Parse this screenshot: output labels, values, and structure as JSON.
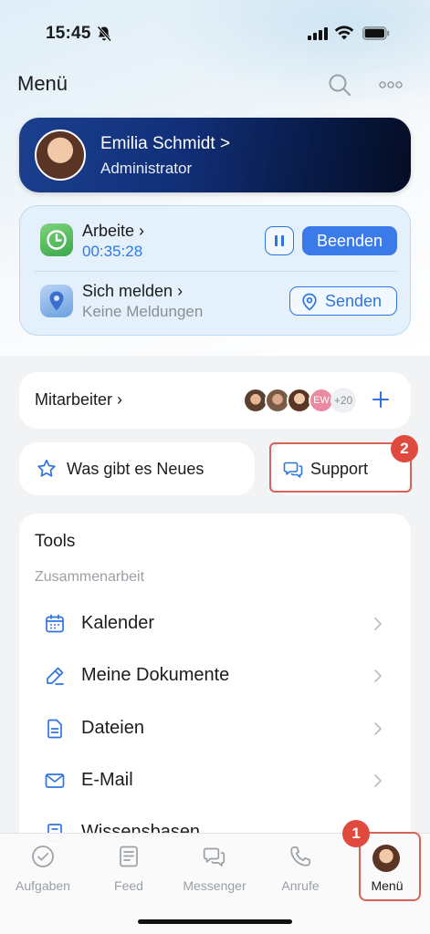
{
  "status_bar": {
    "time": "15:45"
  },
  "header": {
    "title": "Menü"
  },
  "profile": {
    "name": "Emilia Schmidt",
    "name_suffix": ">",
    "role": "Administrator"
  },
  "work": {
    "status_label": "Arbeite",
    "timer": "00:35:28",
    "end_label": "Beenden",
    "report_label": "Sich melden",
    "report_sub": "Keine Meldungen",
    "send_label": "Senden"
  },
  "employees": {
    "label": "Mitarbeiter",
    "initials": "EW",
    "more_count": "+20"
  },
  "news": {
    "label": "Was gibt es Neues"
  },
  "support": {
    "label": "Support"
  },
  "annotations": {
    "step1": "1",
    "step2": "2",
    "color": "#d8635b"
  },
  "tools": {
    "title": "Tools",
    "section": "Zusammenarbeit",
    "items": [
      {
        "label": "Kalender",
        "icon": "calendar-icon"
      },
      {
        "label": "Meine Dokumente",
        "icon": "pen-icon"
      },
      {
        "label": "Dateien",
        "icon": "file-icon"
      },
      {
        "label": "E-Mail",
        "icon": "mail-icon"
      },
      {
        "label": "Wissensbasen",
        "icon": "book-icon"
      }
    ]
  },
  "tabs": [
    {
      "label": "Aufgaben",
      "icon": "check-circle-icon"
    },
    {
      "label": "Feed",
      "icon": "feed-icon"
    },
    {
      "label": "Messenger",
      "icon": "chat-icon"
    },
    {
      "label": "Anrufe",
      "icon": "phone-icon"
    },
    {
      "label": "Menü",
      "icon": "avatar"
    }
  ],
  "colors": {
    "accent": "#3a7ae9",
    "profile_bg": "#0b1f55",
    "badge": "#e04a3e"
  }
}
